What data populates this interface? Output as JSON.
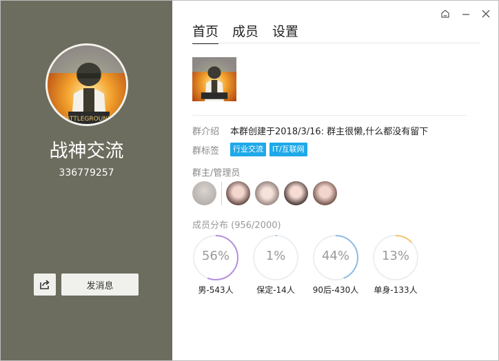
{
  "group": {
    "name": "战神交流",
    "id": "336779257"
  },
  "left_actions": {
    "share_icon": "share-icon",
    "send_label": "发消息"
  },
  "window_controls": [
    "skin-icon",
    "minimize-icon",
    "close-icon"
  ],
  "tabs": [
    {
      "label": "首页",
      "active": true
    },
    {
      "label": "成员",
      "active": false
    },
    {
      "label": "设置",
      "active": false
    }
  ],
  "info": {
    "intro_label": "群介绍",
    "intro_text": "本群创建于2018/3/16:  群主很懒,什么都没有留下",
    "tags_label": "群标签",
    "tags": [
      "行业交流",
      "IT/互联网"
    ]
  },
  "admins": {
    "label": "群主/管理员",
    "count": 5
  },
  "distribution": {
    "title": "成员分布",
    "count": "(956/2000)",
    "stats": [
      {
        "percent_label": "56%",
        "value": 0.56,
        "caption": "男-543人",
        "color": "#b48fe0"
      },
      {
        "percent_label": "1%",
        "value": 0.01,
        "caption": "保定-14人",
        "color": "#9fc6ec"
      },
      {
        "percent_label": "44%",
        "value": 0.44,
        "caption": "90后-430人",
        "color": "#8fbbe6"
      },
      {
        "percent_label": "13%",
        "value": 0.13,
        "caption": "单身-133人",
        "color": "#f3c46b"
      }
    ]
  }
}
